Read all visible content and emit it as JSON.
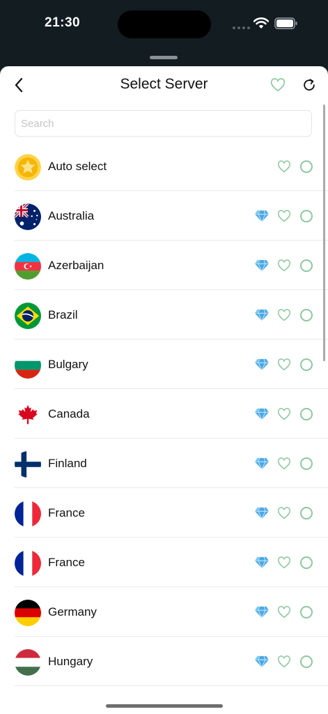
{
  "status_bar": {
    "time": "21:30"
  },
  "header": {
    "title": "Select Server",
    "back_icon": "chevron-left-icon",
    "favorites_icon": "heart-icon",
    "refresh_icon": "refresh-icon"
  },
  "search": {
    "value": "",
    "placeholder": "Search"
  },
  "servers": [
    {
      "name": "Auto select",
      "flag": "star-coin",
      "premium": false
    },
    {
      "name": "Australia",
      "flag": "au",
      "premium": true
    },
    {
      "name": "Azerbaijan",
      "flag": "az",
      "premium": true
    },
    {
      "name": "Brazil",
      "flag": "br",
      "premium": true
    },
    {
      "name": "Bulgary",
      "flag": "bg",
      "premium": true
    },
    {
      "name": "Canada",
      "flag": "ca",
      "premium": true
    },
    {
      "name": "Finland",
      "flag": "fi",
      "premium": true
    },
    {
      "name": "France",
      "flag": "fr",
      "premium": true
    },
    {
      "name": "France",
      "flag": "fr",
      "premium": true
    },
    {
      "name": "Germany",
      "flag": "de",
      "premium": true
    },
    {
      "name": "Hungary",
      "flag": "hu",
      "premium": true
    }
  ],
  "colors": {
    "status_bar_bg": "#121c21",
    "accent_green": "#8dc79f",
    "premium_blue": "#4aa8e6",
    "text": "#111111"
  }
}
